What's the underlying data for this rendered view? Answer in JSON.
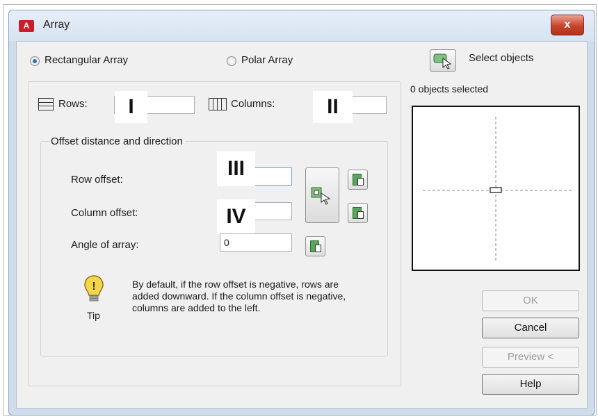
{
  "window": {
    "app_logo_text": "A",
    "title": "Array",
    "close_label": "x"
  },
  "mode": {
    "rectangular_label": "Rectangular Array",
    "polar_label": "Polar Array",
    "selected": "Rectangular Array"
  },
  "grid": {
    "rows_label": "Rows:",
    "rows_value": "",
    "rows_marker": "I",
    "columns_label": "Columns:",
    "columns_value": "",
    "columns_marker": "II"
  },
  "offset": {
    "group_title": "Offset distance and direction",
    "row_offset_label": "Row offset:",
    "row_offset_value": "",
    "row_offset_marker": "III",
    "column_offset_label": "Column offset:",
    "column_offset_value": "",
    "column_offset_marker": "IV",
    "angle_label": "Angle of array:",
    "angle_value": "0"
  },
  "tip": {
    "label": "Tip",
    "text": "By default, if the row offset is negative, rows are added downward.  If the column offset is negative, columns are added to the left."
  },
  "selection": {
    "select_label": "Select objects",
    "count_text": "0 objects selected"
  },
  "buttons": {
    "ok": "OK",
    "cancel": "Cancel",
    "preview": "Preview <",
    "help": "Help"
  },
  "colors": {
    "title_gradient": "#d7e3f1",
    "close_red": "#c7452c",
    "radio_dot": "#3d6db5",
    "pick_icon_green": "#58a55c"
  },
  "icons": [
    "app-logo-icon",
    "close-icon",
    "rows-icon",
    "columns-icon",
    "pick-point-icon",
    "pick-both-icon",
    "select-objects-icon",
    "tip-lightbulb-icon"
  ]
}
